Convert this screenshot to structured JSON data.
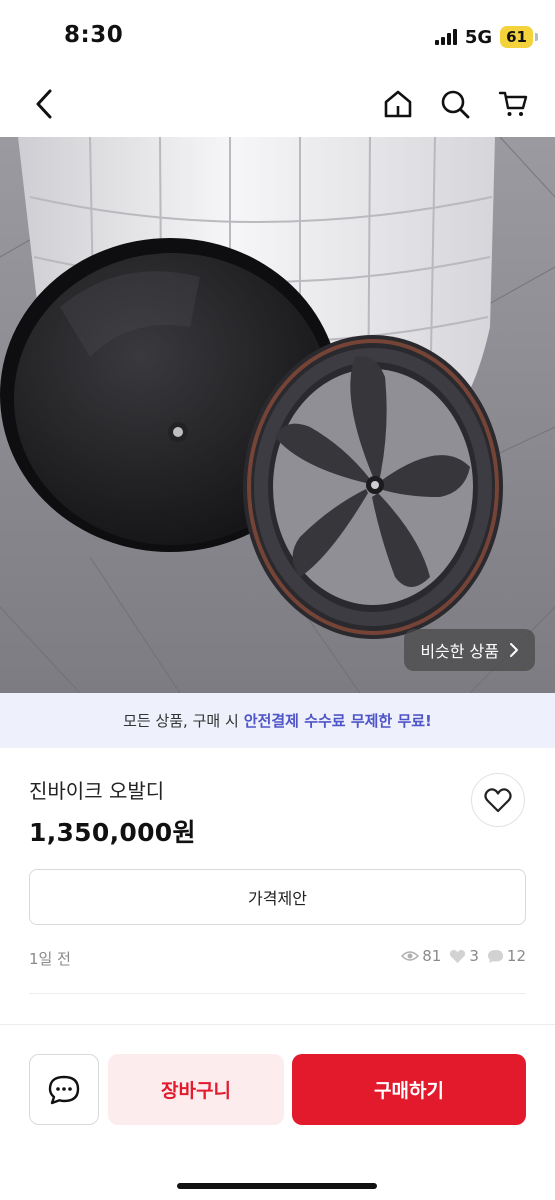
{
  "status_bar": {
    "time": "8:30",
    "network": "5G",
    "battery": "61"
  },
  "nav": {
    "back_icon": "chevron-left-icon",
    "home_icon": "home-icon",
    "search_icon": "search-icon",
    "cart_icon": "cart-icon"
  },
  "hero": {
    "similar_label": "비슷한 상품"
  },
  "banner": {
    "text": "모든 상품, 구매 시",
    "highlight": "안전결제 수수료 무제한 무료!"
  },
  "product": {
    "title": "진바이크 오발디",
    "price": "1,350,000원",
    "offer_label": "가격제안",
    "posted": "1일 전",
    "views": "81",
    "likes": "3",
    "chats": "12"
  },
  "bottom": {
    "cart_label": "장바구니",
    "buy_label": "구매하기"
  },
  "colors": {
    "accent": "#e3192c",
    "banner_highlight": "#4f55c8",
    "battery": "#f4d23c"
  }
}
